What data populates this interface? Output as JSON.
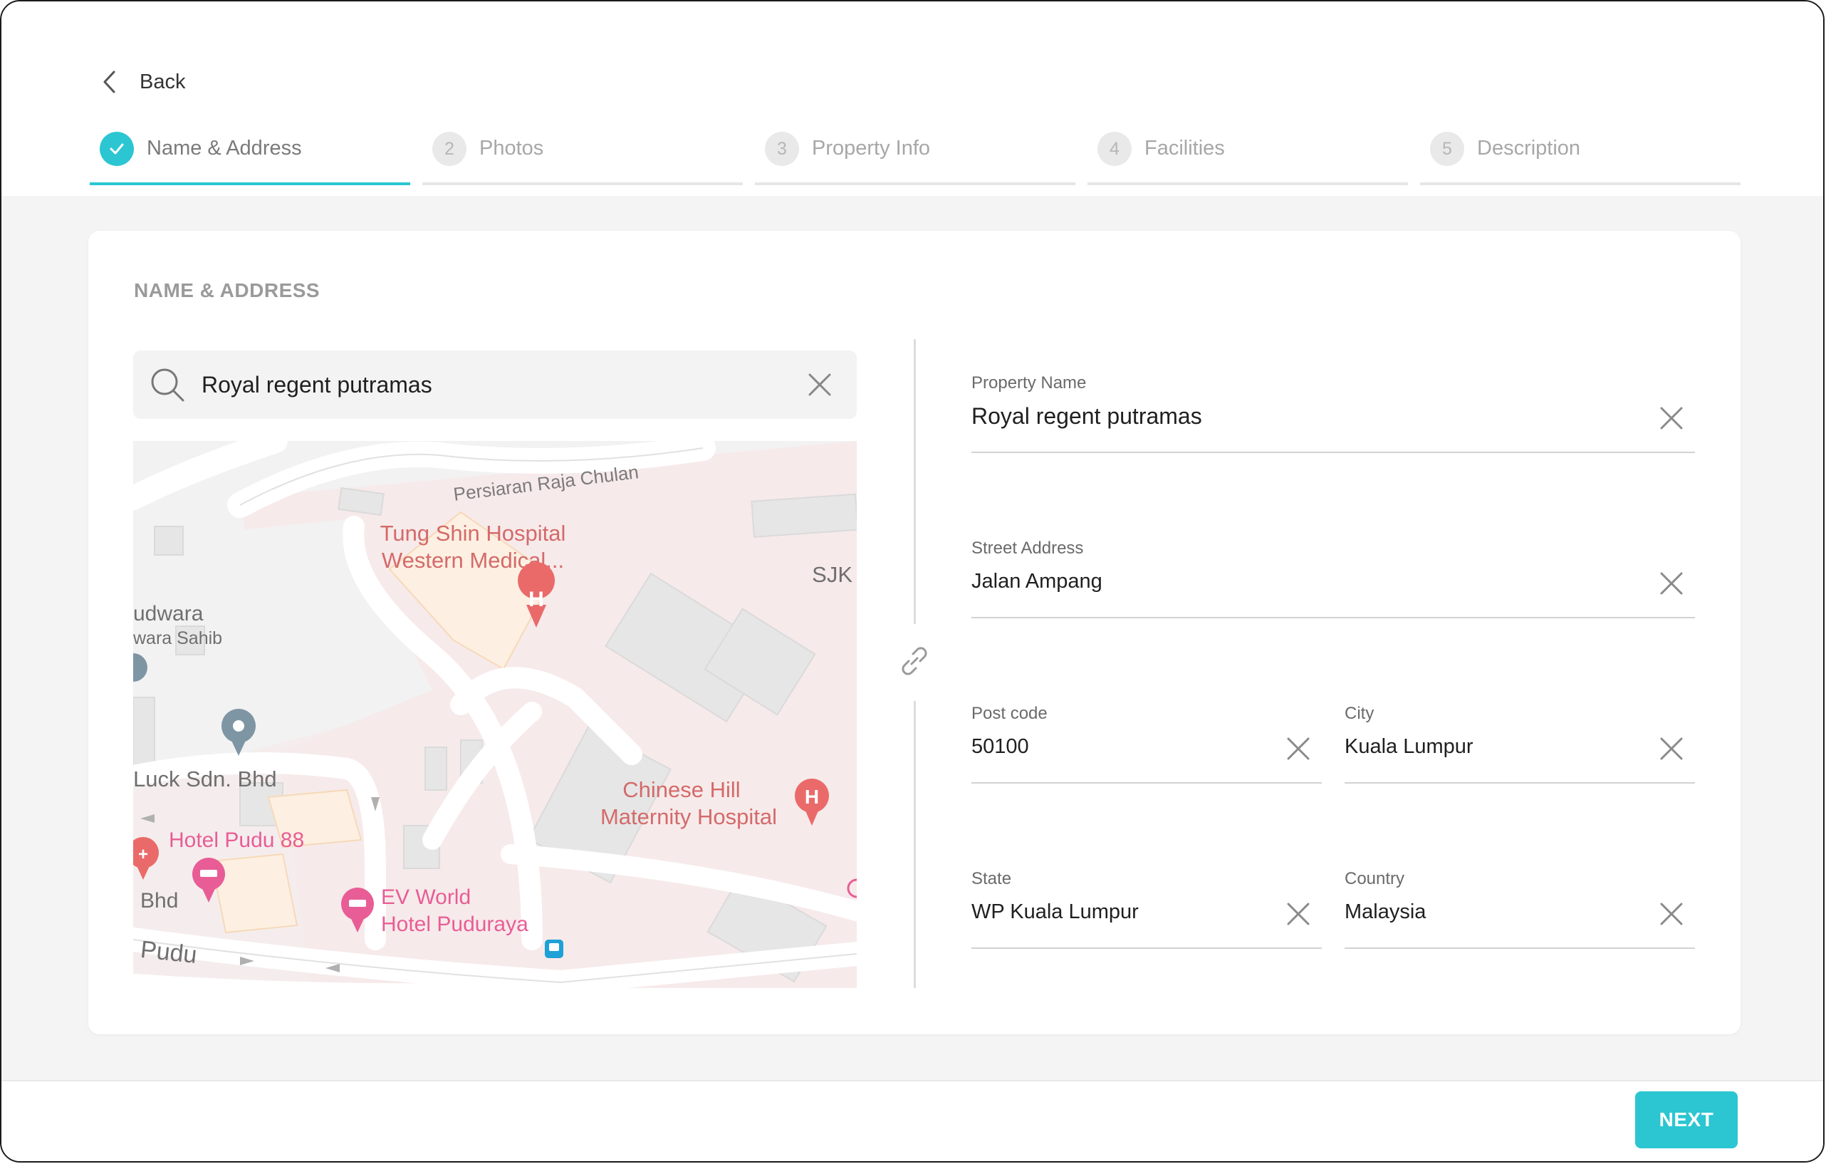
{
  "nav": {
    "back_label": "Back"
  },
  "steps": [
    {
      "number": "",
      "label": "Name & Address",
      "status": "completed"
    },
    {
      "number": "2",
      "label": "Photos",
      "status": "pending"
    },
    {
      "number": "3",
      "label": "Property Info",
      "status": "pending"
    },
    {
      "number": "4",
      "label": "Facilities",
      "status": "pending"
    },
    {
      "number": "5",
      "label": "Description",
      "status": "pending"
    }
  ],
  "section": {
    "title": "NAME & ADDRESS"
  },
  "search": {
    "value": "Royal regent putramas"
  },
  "map": {
    "labels": {
      "road_1": "Persiaran Raja Chulan",
      "hospital_1_line1": "Tung Shin Hospital",
      "hospital_1_line2": "Western Medical...",
      "sjk": "SJK",
      "gurdwara_1": "udwara",
      "gurdwara_2": "wara Sahib",
      "luck": "Luck Sdn. Bhd",
      "hospital_2_line1": "Chinese Hill",
      "hospital_2_line2": "Maternity Hospital",
      "hotel_1": "Hotel Pudu 88",
      "bhd": "Bhd",
      "hotel_2_line1": "EV World",
      "hotel_2_line2": "Hotel Puduraya",
      "road_2": "Pudu"
    }
  },
  "form": {
    "property_name": {
      "label": "Property Name",
      "value": "Royal regent putramas"
    },
    "street_address": {
      "label": "Street Address",
      "value": "Jalan Ampang"
    },
    "post_code": {
      "label": "Post code",
      "value": "50100"
    },
    "city": {
      "label": "City",
      "value": "Kuala Lumpur"
    },
    "state": {
      "label": "State",
      "value": "WP Kuala Lumpur"
    },
    "country": {
      "label": "Country",
      "value": "Malaysia"
    }
  },
  "footer": {
    "next_label": "NEXT"
  },
  "colors": {
    "accent": "#2bc6d2",
    "hospital_pin": "#ea6a6a",
    "hotel_pin": "#e85d96",
    "poi_pin": "#7e95a4",
    "transit": "#1da1d6"
  }
}
